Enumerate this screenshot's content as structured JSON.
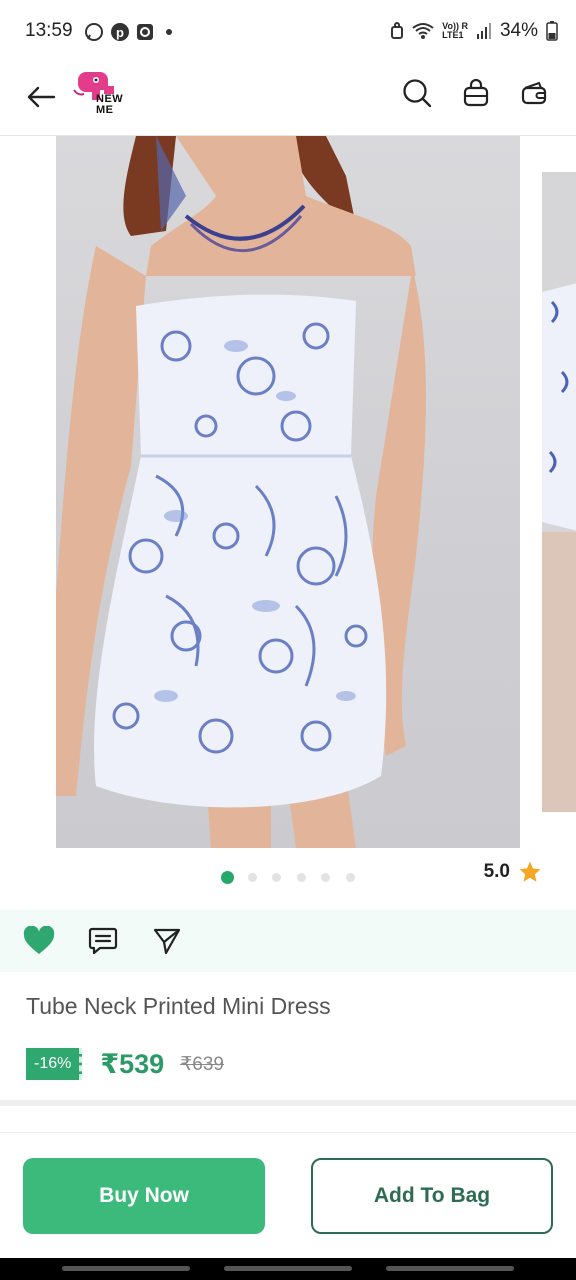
{
  "status_bar": {
    "time": "13:59",
    "battery": "34%",
    "network_label_top": "Vo)) R",
    "network_label_bottom": "LTE1",
    "icons": [
      "whatsapp-icon",
      "pinterest-icon",
      "app-notification-icon",
      "dot-icon",
      "alarm-icon",
      "wifi-icon",
      "signal-icon",
      "battery-icon"
    ]
  },
  "header": {
    "logo_text_1": "NEW",
    "logo_text_2": "ME",
    "icons": [
      "back-arrow-icon",
      "search-icon",
      "bag-icon",
      "wallet-icon"
    ]
  },
  "carousel": {
    "dot_count": 6,
    "active_dot": 0
  },
  "rating": {
    "value": "5.0"
  },
  "actions": {
    "icons": [
      "heart-icon",
      "comment-icon",
      "share-icon"
    ]
  },
  "product": {
    "title": "Tube Neck Printed Mini Dress",
    "discount": "-16%",
    "price": "₹539",
    "mrp": "₹639"
  },
  "buttons": {
    "buy_now": "Buy Now",
    "add_to_bag": "Add To Bag"
  },
  "colors": {
    "accent": "#3cba7c",
    "price": "#2b9a66",
    "discount_bg": "#2ea86f",
    "outline": "#2e6b53"
  }
}
